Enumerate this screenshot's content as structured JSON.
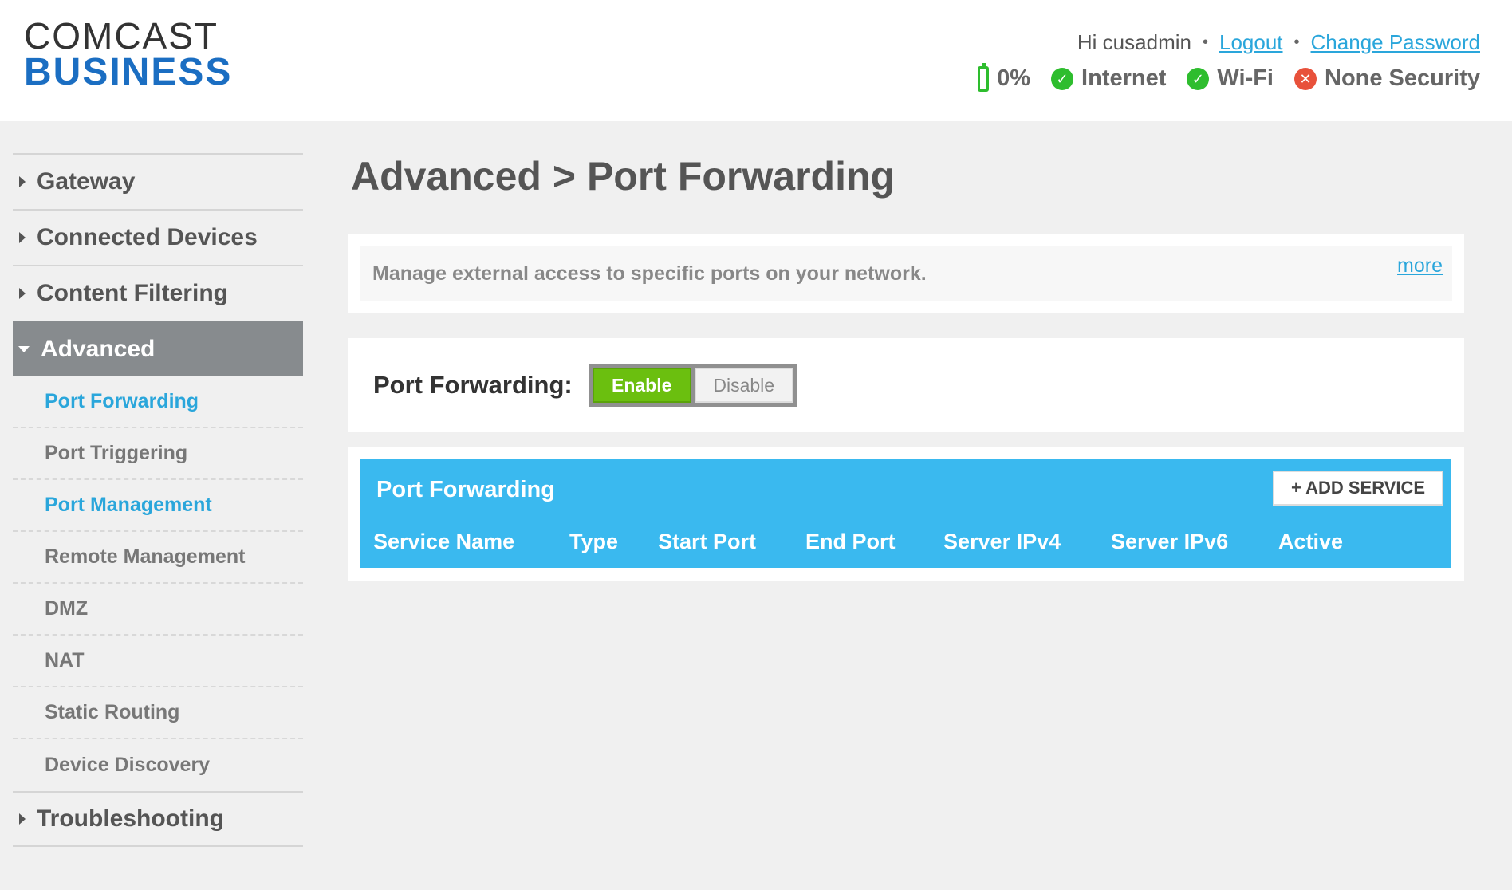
{
  "header": {
    "logo_line1": "COMCAST",
    "logo_line2": "BUSINESS",
    "greeting": "Hi cusadmin",
    "separator": "•",
    "logout_label": "Logout",
    "change_password_label": "Change Password",
    "status": {
      "battery": "0%",
      "internet": "Internet",
      "wifi": "Wi-Fi",
      "security": "None Security"
    }
  },
  "sidebar": {
    "top_items": [
      "Gateway",
      "Connected Devices",
      "Content Filtering",
      "Advanced",
      "Troubleshooting"
    ],
    "sub_items": [
      "Port Forwarding",
      "Port Triggering",
      "Port Management",
      "Remote Management",
      "DMZ",
      "NAT",
      "Static Routing",
      "Device Discovery"
    ]
  },
  "main": {
    "title": "Advanced > Port Forwarding",
    "description": "Manage external access to specific ports on your network.",
    "more_label": "more",
    "toggle_label": "Port Forwarding:",
    "enable_label": "Enable",
    "disable_label": "Disable",
    "table_title": "Port Forwarding",
    "add_service_label": "+ ADD SERVICE",
    "columns": [
      "Service Name",
      "Type",
      "Start Port",
      "End Port",
      "Server IPv4",
      "Server IPv6",
      "Active"
    ]
  },
  "colors": {
    "accent": "#3ab9ef",
    "enable": "#6bbf0f",
    "ok": "#2ebd2e",
    "error": "#e8513b",
    "logo_blue": "#1b6ec2"
  }
}
